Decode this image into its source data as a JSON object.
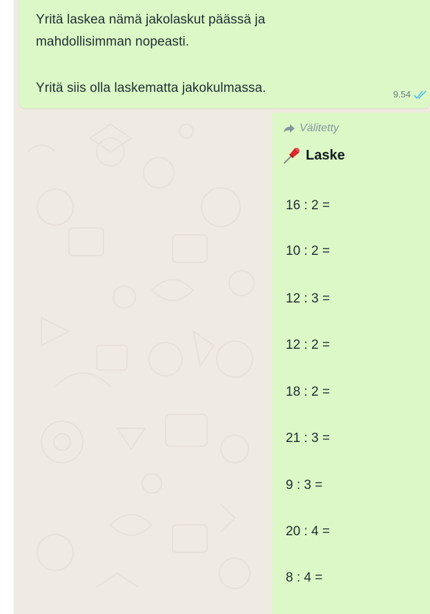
{
  "message1": {
    "lines": [
      "Yritä laskea nämä jakolaskut päässä ja",
      "mahdollisimman nopeasti.",
      "Yritä siis olla laskematta jakokulmassa."
    ],
    "time": "9.54",
    "status_icon": "double-check-icon"
  },
  "message2": {
    "forwarded_label": "Välitetty",
    "forwarded_icon": "forward-arrow-icon",
    "title_icon": "pushpin-icon",
    "title": "Laske",
    "tasks": [
      "16 : 2 =",
      "10 : 2 =",
      "12 : 3 =",
      "12 : 2 =",
      "18 : 2 =",
      "21 : 3 =",
      "9 : 3 =",
      "20 : 4 =",
      "8 : 4 ="
    ]
  },
  "colors": {
    "chat_background": "#efeae2",
    "outgoing_bubble": "#dcf8c6",
    "read_ticks": "#53bdeb",
    "meta_text": "#667781"
  }
}
